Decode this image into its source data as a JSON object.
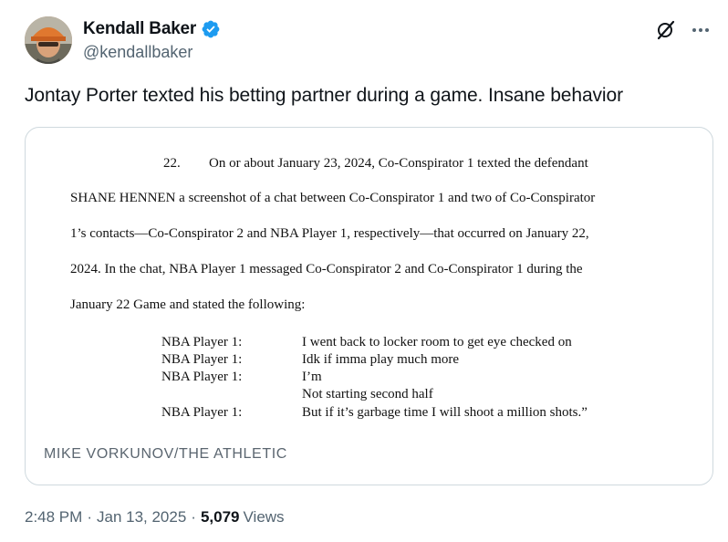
{
  "author": {
    "name": "Kendall Baker",
    "handle": "@kendallbaker",
    "verified": true
  },
  "tweet": {
    "text": "Jontay Porter texted his betting partner during a game. Insane behavior"
  },
  "document": {
    "paragraph_number": "22.",
    "lines": [
      "On or about January 23, 2024, Co-Conspirator 1 texted the defendant",
      "SHANE HENNEN a screenshot of a chat between Co-Conspirator 1 and two of Co-Conspirator",
      "1’s contacts—Co-Conspirator 2 and NBA Player 1, respectively—that occurred on January 22,",
      "2024.   In the chat, NBA Player 1 messaged Co-Conspirator 2 and Co-Conspirator 1 during the",
      "January 22 Game and stated the following:"
    ],
    "chat": [
      {
        "speaker": "NBA Player 1:",
        "message": "I went back to locker room to get eye checked on"
      },
      {
        "speaker": "NBA Player 1:",
        "message": "Idk if imma play much more"
      },
      {
        "speaker": "NBA Player 1:",
        "message": "I’m"
      },
      {
        "speaker": "",
        "message": "Not starting second half"
      },
      {
        "speaker": "NBA Player 1:",
        "message": "But if it’s garbage time I will shoot a million shots.”"
      }
    ],
    "credit": "MIKE VORKUNOV/THE ATHLETIC"
  },
  "meta": {
    "time": "2:48 PM",
    "separator": "·",
    "date": "Jan 13, 2025",
    "views_count": "5,079",
    "views_label": "Views"
  },
  "colors": {
    "verified_badge": "#1d9bf0",
    "secondary_text": "#536471",
    "primary_text": "#0f1419",
    "card_border": "#cfd9de"
  },
  "icons": {
    "grok": "grok-icon",
    "more": "more-icon",
    "verified": "verified-badge-icon"
  }
}
